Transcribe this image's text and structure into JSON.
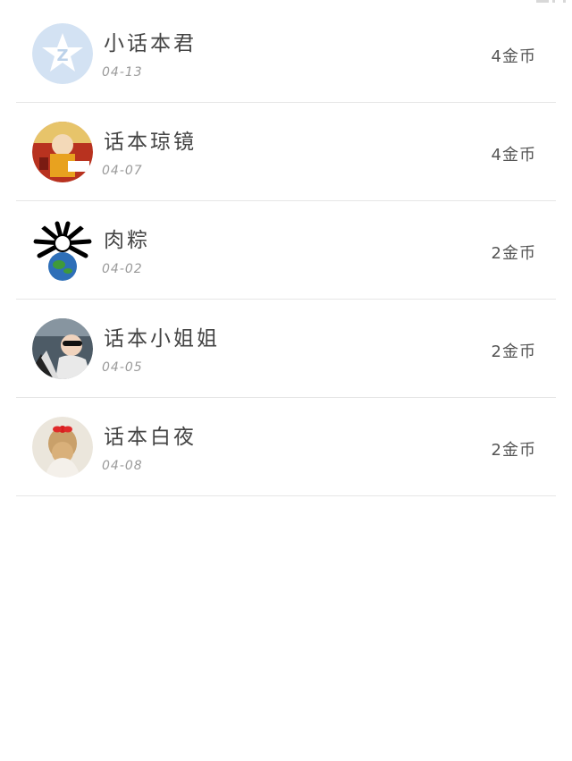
{
  "items": [
    {
      "name": "小话本君",
      "date": "04-13",
      "coins": "4金币",
      "avatar_icon": "qq-star-avatar",
      "avatar_color": "#cfe0f2"
    },
    {
      "name": "话本琼镜",
      "date": "04-07",
      "coins": "4金币",
      "avatar_icon": "monk-cartoon-avatar",
      "avatar_color": "#c0392b"
    },
    {
      "name": "肉粽",
      "date": "04-02",
      "coins": "2金币",
      "avatar_icon": "spider-earth-avatar",
      "avatar_color": "#000000"
    },
    {
      "name": "话本小姐姐",
      "date": "04-05",
      "coins": "2金币",
      "avatar_icon": "sunglasses-person-avatar",
      "avatar_color": "#5a6b7a"
    },
    {
      "name": "话本白夜",
      "date": "04-08",
      "coins": "2金币",
      "avatar_icon": "girl-red-bow-avatar",
      "avatar_color": "#e8ddd0"
    }
  ]
}
